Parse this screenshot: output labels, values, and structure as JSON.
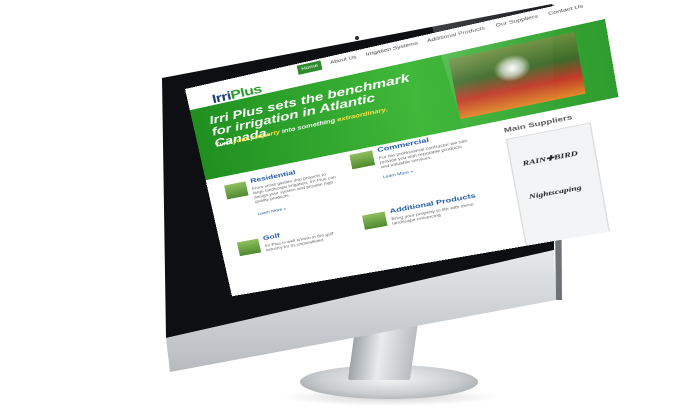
{
  "site": {
    "logo_part1": "Irri",
    "logo_part2": "Plus",
    "nav": [
      "Home",
      "About Us",
      "Irrigation Systems",
      "Additional Products",
      "Our Suppliers",
      "Contact Us"
    ],
    "banner": {
      "headline": "Irri Plus sets the benchmark for irrigation in Atlantic Canada.",
      "tagline_prefix": "Turn ",
      "tagline_hl1": "your property",
      "tagline_mid": " into something ",
      "tagline_hl2": "extraordinary."
    },
    "cards": [
      {
        "title": "Residential",
        "text": "From small garden drip projects to large landscape irrigation, Irri Plus can design your system and provide high quality products.",
        "link": "Learn More »"
      },
      {
        "title": "Commercial",
        "text": "For the professional contractor we can provide you with reputable products and valuable services.",
        "link": "Learn More »"
      },
      {
        "title": "Golf",
        "text": "Irri Plus is well known in the golf industry for its unparalleled",
        "link": ""
      },
      {
        "title": "Additional Products",
        "text": "Bring your property to life with these landscape enhancing",
        "link": ""
      }
    ],
    "suppliers": {
      "title": "Main Suppliers",
      "logos": [
        "RAIN✚BIRD",
        "Nightscaping"
      ]
    }
  },
  "colors": {
    "banner_green": "#2f9c2f",
    "link_blue": "#1e5aa6",
    "accent_yellow": "#ffe14a"
  }
}
